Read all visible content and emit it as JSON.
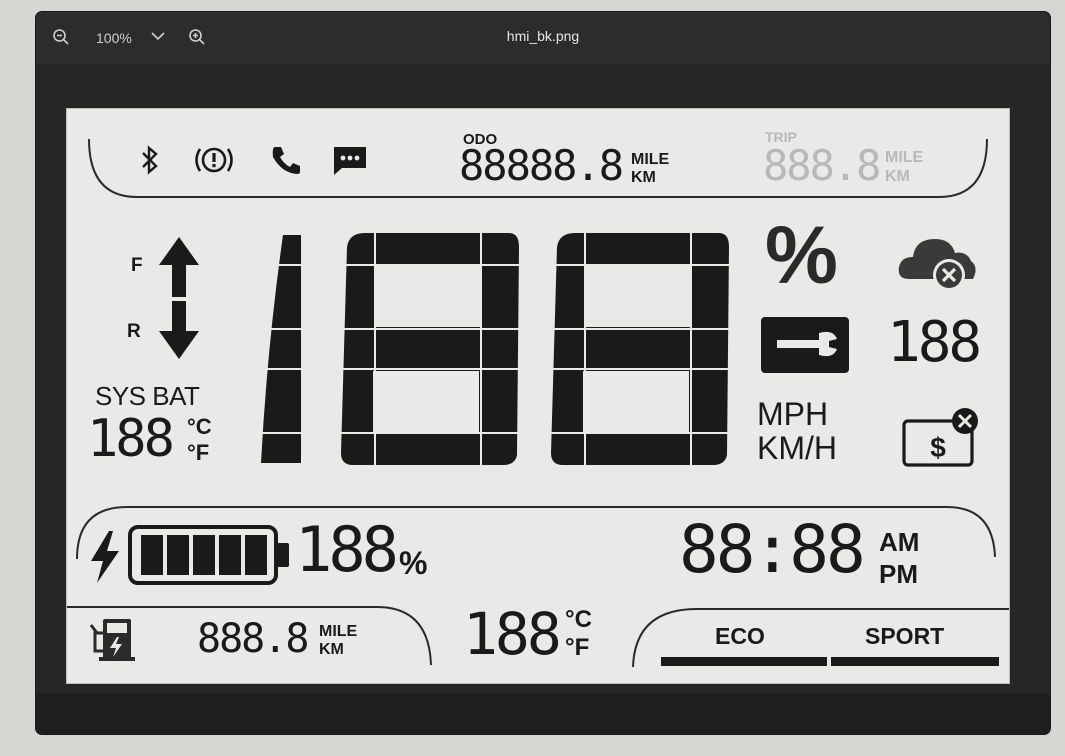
{
  "viewer": {
    "zoom": "100%",
    "title": "hmi_bk.png",
    "icons": [
      "zoom-out-icon",
      "chevron-down-icon",
      "zoom-in-icon"
    ]
  },
  "lcd": {
    "odo": {
      "label": "ODO",
      "value": "88888.8",
      "unit_top": "MILE",
      "unit_bottom": "KM"
    },
    "trip": {
      "label": "TRIP",
      "value": "888.8",
      "unit_top": "MILE",
      "unit_bottom": "KM"
    },
    "status_icons": [
      "bluetooth-icon",
      "brake-warning-icon",
      "phone-icon",
      "message-icon"
    ],
    "gear": {
      "forward": "F",
      "reverse": "R"
    },
    "sys_bat": {
      "label": "SYS BAT",
      "value": "188",
      "unit_c": "°C",
      "unit_f": "°F"
    },
    "speed": {
      "value": "188"
    },
    "speed_units": {
      "mph": "MPH",
      "kmh": "KM/H"
    },
    "percent_symbol": "%",
    "right_value": "188",
    "right_icons": [
      "cloud-error-icon",
      "wrench-icon",
      "payment-error-icon"
    ],
    "battery": {
      "value": "188",
      "unit": "%",
      "bars_total": 5,
      "bars_filled": 5
    },
    "clock": {
      "value": "88:88",
      "am": "AM",
      "pm": "PM"
    },
    "range": {
      "value": "888.8",
      "unit_top": "MILE",
      "unit_bottom": "KM"
    },
    "temp": {
      "value": "188",
      "unit_c": "°C",
      "unit_f": "°F"
    },
    "modes": {
      "eco": "ECO",
      "sport": "SPORT"
    },
    "colors": {
      "segment": "#1a1a1a",
      "lcd_bg": "#e9e9e7",
      "dim": "#b8b8b6"
    }
  }
}
